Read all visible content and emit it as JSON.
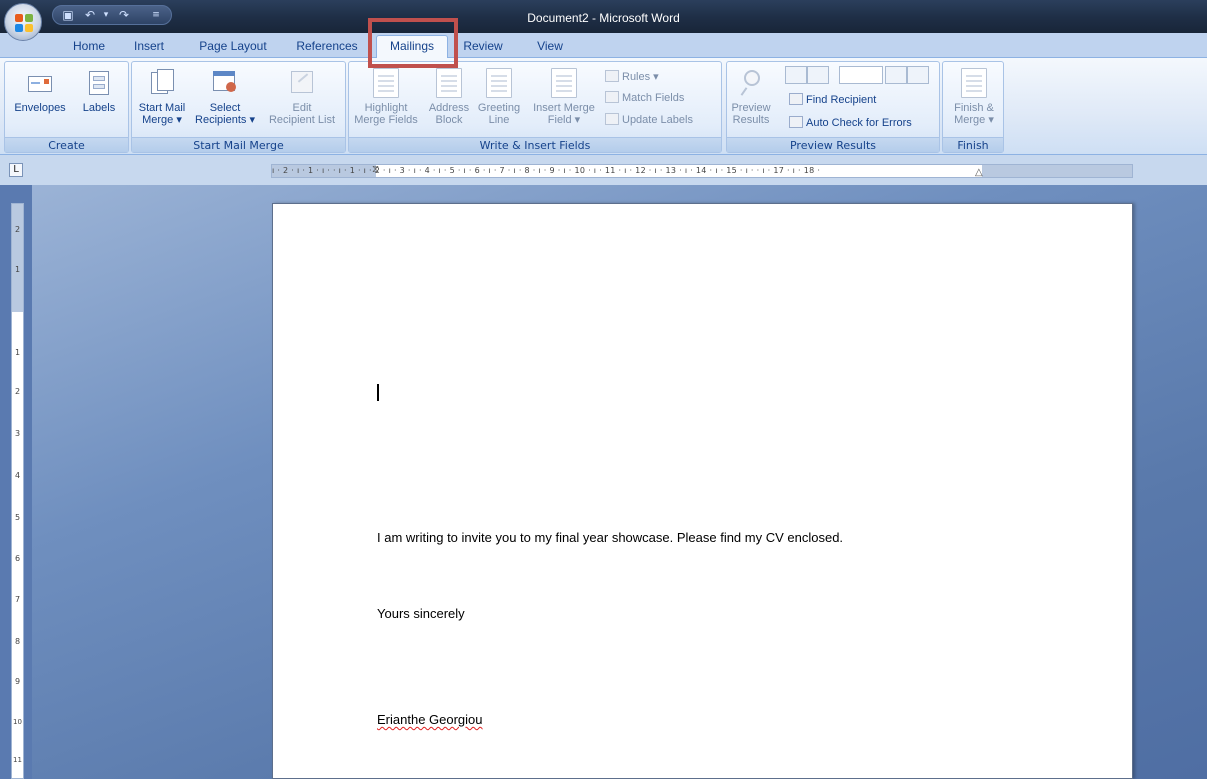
{
  "window": {
    "title": "Document2 - Microsoft Word"
  },
  "tabs": [
    {
      "label": "Home"
    },
    {
      "label": "Insert"
    },
    {
      "label": "Page Layout"
    },
    {
      "label": "References"
    },
    {
      "label": "Mailings",
      "active": true
    },
    {
      "label": "Review"
    },
    {
      "label": "View"
    }
  ],
  "ribbon": {
    "create": {
      "label": "Create",
      "envelopes": "Envelopes",
      "labels": "Labels"
    },
    "start_mail_merge": {
      "label": "Start Mail Merge",
      "start_l1": "Start Mail",
      "start_l2": "Merge ▾",
      "select_l1": "Select",
      "select_l2": "Recipients ▾",
      "edit_l1": "Edit",
      "edit_l2": "Recipient List"
    },
    "write_insert": {
      "label": "Write & Insert Fields",
      "highlight_l1": "Highlight",
      "highlight_l2": "Merge Fields",
      "address_l1": "Address",
      "address_l2": "Block",
      "greeting_l1": "Greeting",
      "greeting_l2": "Line",
      "insert_l1": "Insert Merge",
      "insert_l2": "Field ▾",
      "rules": "Rules ▾",
      "match_fields": "Match Fields",
      "update_labels": "Update Labels"
    },
    "preview": {
      "label": "Preview Results",
      "preview_l1": "Preview",
      "preview_l2": "Results",
      "find_recipient": "Find Recipient",
      "auto_check": "Auto Check for Errors"
    },
    "finish": {
      "label": "Finish",
      "finish_l1": "Finish &",
      "finish_l2": "Merge ▾"
    }
  },
  "ruler": {
    "horizontal": "ı · 2 · ı · 1 · ı ·  · ı · 1 · ı · 2 · ı · 3 · ı · 4 · ı · 5 · ı · 6 · ı · 7 · ı · 8 · ı · 9 · ı · 10 · ı · 11 · ı · 12 · ı · 13 · ı · 14 · ı · 15 · ı ·  · ı · 17 · ı · 18 ·",
    "vertical_numbers": [
      "2",
      "1",
      "1",
      "2",
      "3",
      "4",
      "5",
      "6",
      "7",
      "8",
      "9",
      "10",
      "11"
    ],
    "tab_selector": "L"
  },
  "document": {
    "body": "I am writing to invite you to my final year showcase.  Please find my CV enclosed.",
    "closing": "Yours sincerely",
    "signature": "Erianthe Georgiou"
  }
}
